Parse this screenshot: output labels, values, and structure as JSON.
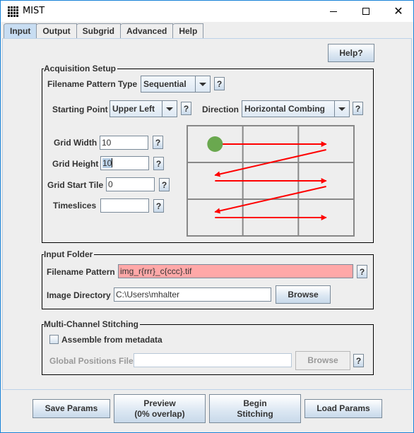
{
  "window": {
    "title": "MIST",
    "icon": "grid-app-icon",
    "controls": [
      "minimize-icon",
      "maximize-icon",
      "close-icon"
    ],
    "accent_color": "#1883d7"
  },
  "tabs": [
    {
      "label": "Input",
      "active": true
    },
    {
      "label": "Output",
      "active": false
    },
    {
      "label": "Subgrid",
      "active": false
    },
    {
      "label": "Advanced",
      "active": false
    },
    {
      "label": "Help",
      "active": false
    }
  ],
  "help_button": "Help?",
  "help_glyph": "?",
  "acquisition": {
    "title": "Acquisition Setup",
    "filename_pattern_type": {
      "label": "Filename Pattern Type",
      "value": "Sequential"
    },
    "starting_point": {
      "label": "Starting Point",
      "value": "Upper Left"
    },
    "direction": {
      "label": "Direction",
      "value": "Horizontal Combing"
    },
    "grid_width": {
      "label": "Grid Width",
      "value": "10"
    },
    "grid_height": {
      "label": "Grid Height",
      "value": "10"
    },
    "grid_start_tile": {
      "label": "Grid Start Tile",
      "value": "0"
    },
    "timeslices": {
      "label": "Timeslices",
      "value": ""
    },
    "diagram": {
      "rows": 3,
      "cols": 3,
      "start_marker_color": "#6aa84f",
      "arrow_color": "#ff0000",
      "grid_color": "#888888"
    }
  },
  "input_folder": {
    "title": "Input Folder",
    "filename_pattern": {
      "label": "Filename Pattern",
      "value": "img_r{rrr}_c{ccc}.tif",
      "error_color": "#ffa8a8"
    },
    "image_directory": {
      "label": "Image Directory",
      "value": "C:\\Users\\mhalter"
    },
    "browse_label": "Browse"
  },
  "multi_channel": {
    "title": "Multi-Channel Stitching",
    "assemble_checkbox": {
      "label": "Assemble from metadata",
      "checked": false
    },
    "global_positions": {
      "label": "Global Positions File",
      "value": "",
      "enabled": false
    },
    "browse_label": "Browse"
  },
  "footer": {
    "save_params": "Save Params",
    "preview_line1": "Preview",
    "preview_line2": "(0% overlap)",
    "begin_line1": "Begin",
    "begin_line2": "Stitching",
    "load_params": "Load Params"
  }
}
